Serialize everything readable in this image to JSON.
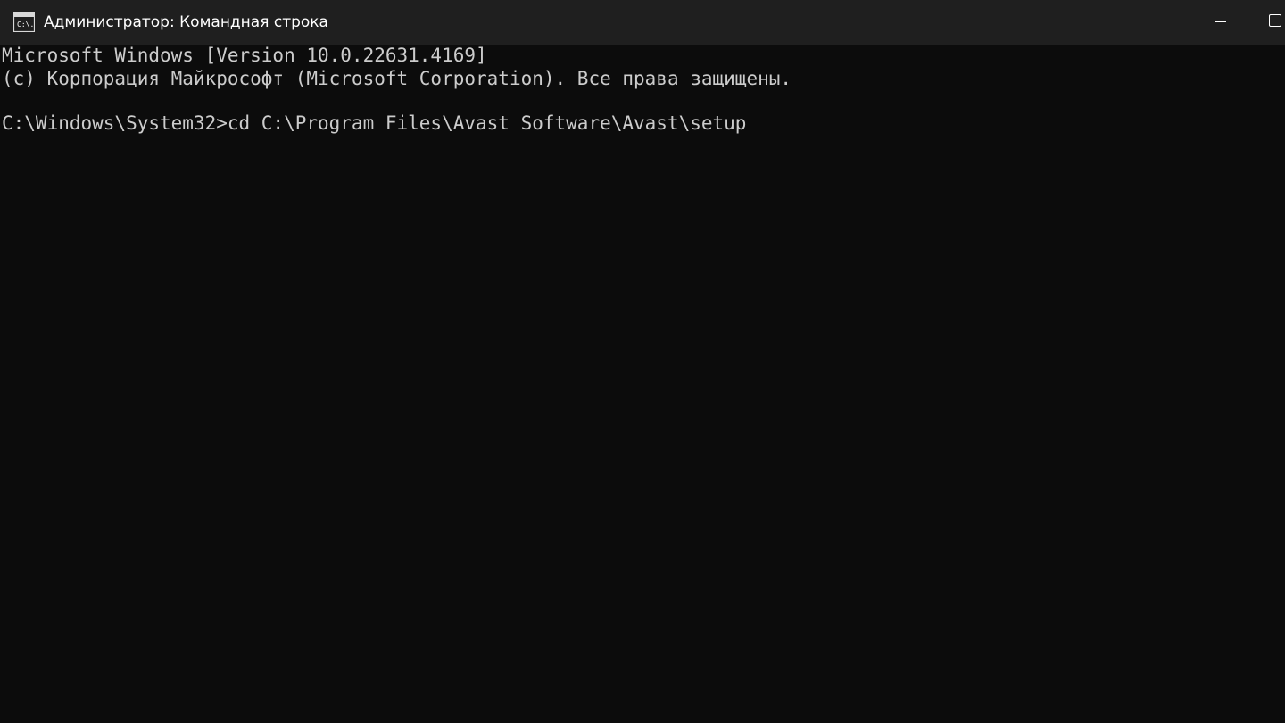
{
  "window": {
    "title": "Администратор: Командная строка",
    "icon": "cmd-icon",
    "icon_text": "C:\\.",
    "accent_background": "#0c0c0c",
    "titlebar_background": "#1f1f1f",
    "text_color": "#cccccc"
  },
  "caption_buttons": {
    "minimize_icon": "minimize-icon",
    "maximize_icon": "maximize-icon"
  },
  "console": {
    "lines": [
      "Microsoft Windows [Version 10.0.22631.4169]",
      "(c) Корпорация Майкрософт (Microsoft Corporation). Все права защищены.",
      "",
      "C:\\Windows\\System32>cd C:\\Program Files\\Avast Software\\Avast\\setup"
    ]
  }
}
